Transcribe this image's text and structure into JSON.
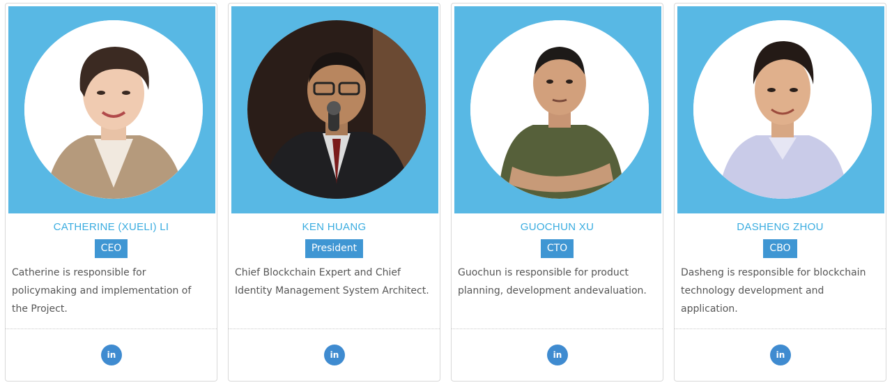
{
  "team": [
    {
      "name": "CATHERINE (XUELI) LI",
      "role": "CEO",
      "bio": "Catherine is responsible for policymaking and implementation of the Project.",
      "social_label": "in",
      "social_icon": "linkedin-icon"
    },
    {
      "name": "KEN HUANG",
      "role": "President",
      "bio": "Chief Blockchain Expert and Chief Identity Management System Architect.",
      "social_label": "in",
      "social_icon": "linkedin-icon"
    },
    {
      "name": "GUOCHUN XU",
      "role": "CTO",
      "bio": "Guochun is responsible for product planning, development andevaluation.",
      "social_label": "in",
      "social_icon": "linkedin-icon"
    },
    {
      "name": "DASHENG ZHOU",
      "role": "CBO",
      "bio": "Dasheng is responsible for blockchain technology development and application.",
      "social_label": "in",
      "social_icon": "linkedin-icon"
    }
  ],
  "colors": {
    "photo_background": "#58b8e4",
    "name_text": "#39ace0",
    "role_badge": "#3f96d3",
    "linkedin_button": "#3f8bd0"
  }
}
